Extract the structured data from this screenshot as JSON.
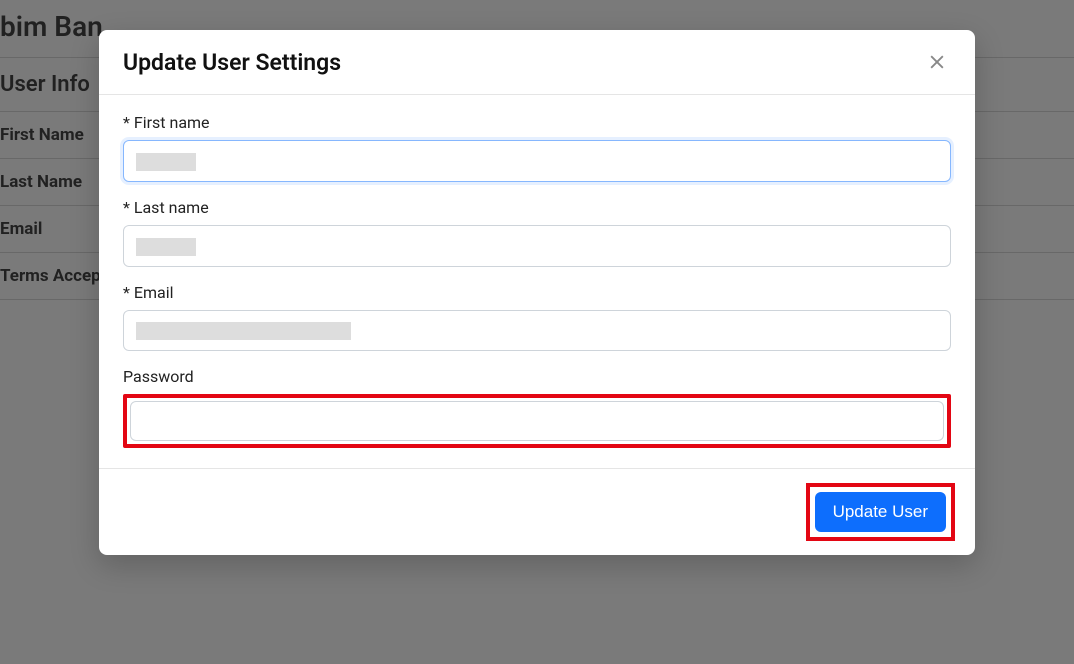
{
  "background": {
    "title": "bim Ban",
    "subtitle": "User Info",
    "rows": [
      "First Name",
      "Last Name",
      "Email",
      "Terms Accep"
    ]
  },
  "modal": {
    "title": "Update User Settings",
    "fields": {
      "first_name": {
        "label": "* First name",
        "value": ""
      },
      "last_name": {
        "label": "* Last name",
        "value": ""
      },
      "email": {
        "label": "* Email",
        "value": ""
      },
      "password": {
        "label": "Password",
        "value": ""
      }
    },
    "submit_label": "Update User"
  }
}
